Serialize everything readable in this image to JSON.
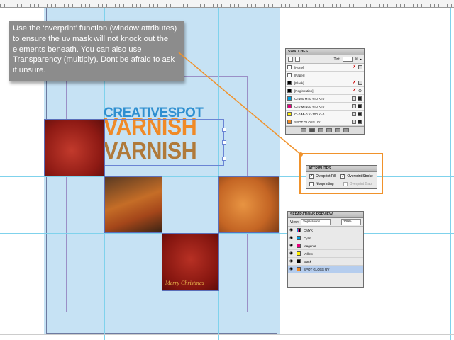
{
  "annotation": {
    "text": "Use the ‘overprint’ function (window;attributes) to ensure the uv mask will not knock out the elements beneath. You can also use Transparency (multiply). Dont be afraid to ask if unsure."
  },
  "artwork": {
    "line1": "CREATIVESPOT",
    "line2": "VARNISH",
    "line3": "VARNISH",
    "photo_caption": "Merry Christmas"
  },
  "swatches": {
    "title": "SWATCHES",
    "tint_label": "Tint:",
    "tint_value": "",
    "tint_unit": "%",
    "items": [
      {
        "name": "[None]",
        "color": "#ffffff"
      },
      {
        "name": "[Paper]",
        "color": "#ffffff"
      },
      {
        "name": "[Black]",
        "color": "#000000"
      },
      {
        "name": "[Registration]",
        "color": "#000000"
      },
      {
        "name": "C=100 M=0 Y=0 K=0",
        "color": "#00a0e0"
      },
      {
        "name": "C=0 M=100 Y=0 K=0",
        "color": "#e6007e"
      },
      {
        "name": "C=0 M=0 Y=100 K=0",
        "color": "#fff000"
      },
      {
        "name": "SPOT GLOSS UV",
        "color": "#f08a26"
      }
    ]
  },
  "attributes": {
    "title": "ATTRIBUTES",
    "overprint_fill": "Overprint Fill",
    "overprint_stroke": "Overprint Stroke",
    "nonprinting": "Nonprinting",
    "overprint_gap": "Overprint Gap"
  },
  "separations": {
    "title": "SEPARATIONS PREVIEW",
    "view_label": "View:",
    "view_value": "Separations",
    "zoom_value": "100%",
    "items": [
      {
        "name": "CMYK",
        "color": "cmyk"
      },
      {
        "name": "Cyan",
        "color": "#00a0e0"
      },
      {
        "name": "Magenta",
        "color": "#e6007e"
      },
      {
        "name": "Yellow",
        "color": "#fff000"
      },
      {
        "name": "Black",
        "color": "#000000"
      },
      {
        "name": "SPOT GLOSS UV",
        "color": "#f08a26"
      }
    ]
  },
  "colors": {
    "accent_orange": "#f0922b",
    "page_blue": "#c6e2f4",
    "guide_cyan": "#7fd2ec"
  }
}
